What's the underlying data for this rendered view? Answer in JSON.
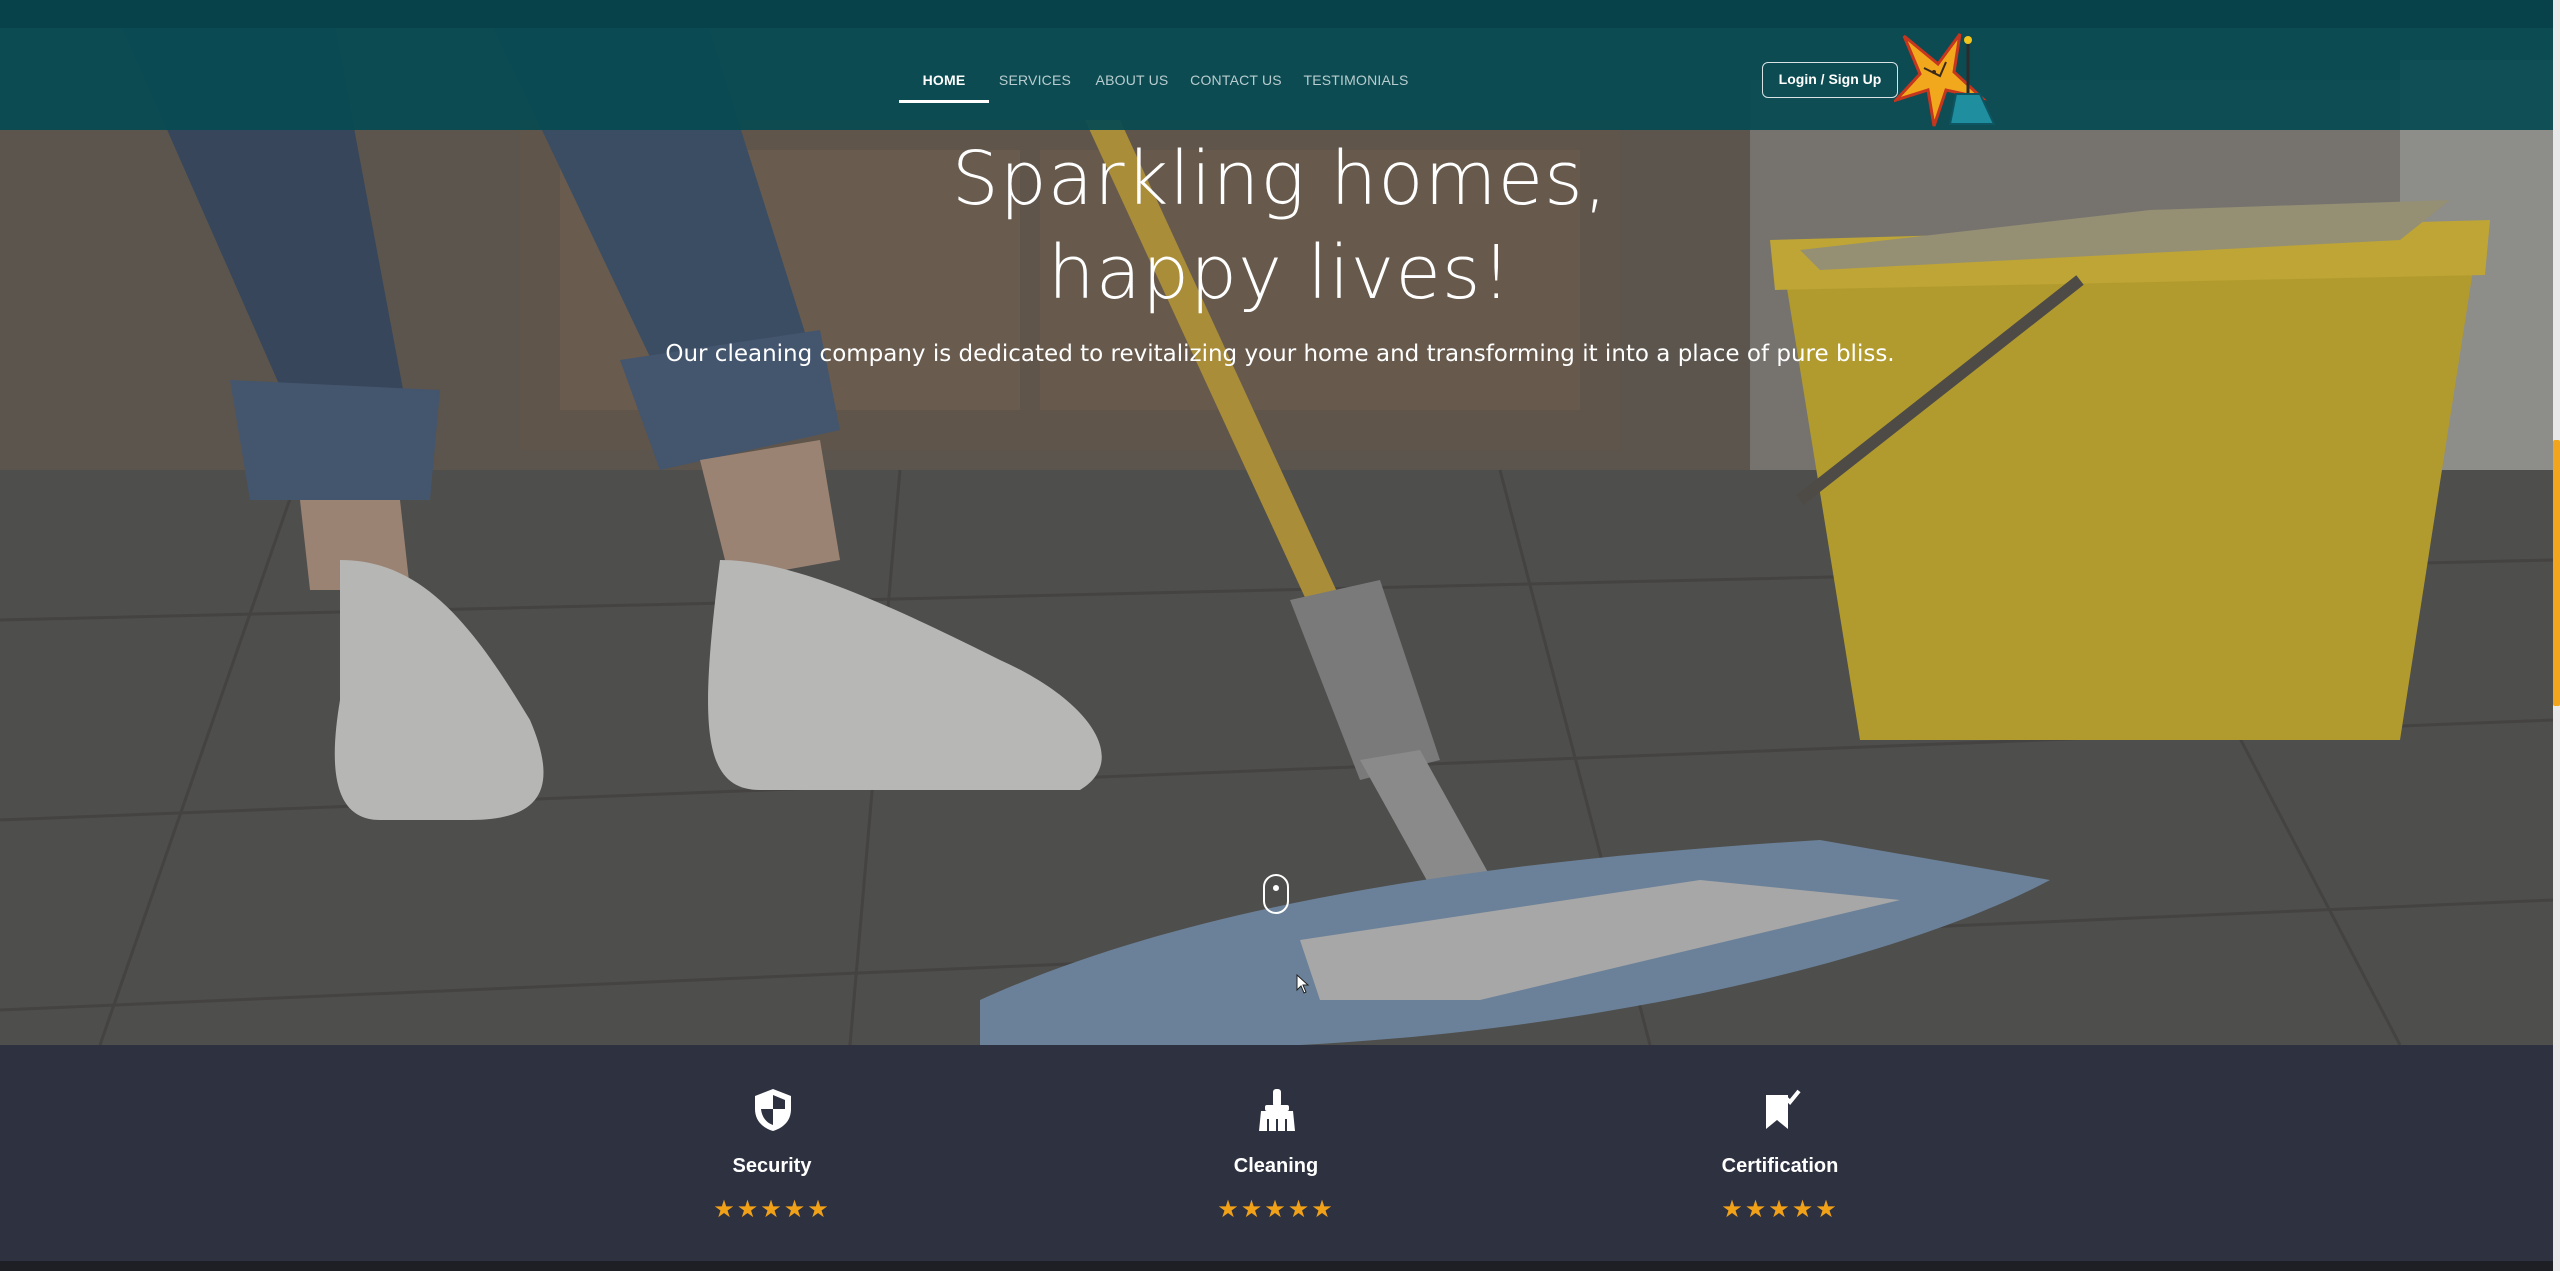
{
  "nav": {
    "items": [
      {
        "label": "HOME",
        "active": true
      },
      {
        "label": "SERVICES",
        "active": false
      },
      {
        "label": "ABOUT US",
        "active": false
      },
      {
        "label": "CONTACT US",
        "active": false
      },
      {
        "label": "TESTIMONIALS",
        "active": false
      }
    ],
    "login_label": "Login / Sign Up"
  },
  "hero": {
    "title_line1": "Sparkling homes,",
    "title_line2": "happy lives!",
    "subtitle": "Our cleaning company is dedicated to revitalizing your home and transforming it into a place of pure bliss."
  },
  "features": [
    {
      "label": "Security",
      "icon": "shield-icon",
      "rating": 5,
      "stars": "★★★★★"
    },
    {
      "label": "Cleaning",
      "icon": "broom-icon",
      "rating": 5,
      "stars": "★★★★★"
    },
    {
      "label": "Certification",
      "icon": "bookmark-check-icon",
      "rating": 5,
      "stars": "★★★★★"
    }
  ],
  "colors": {
    "header": "#064a52",
    "accent": "#f0a118",
    "features_bg": "#2e3140"
  }
}
